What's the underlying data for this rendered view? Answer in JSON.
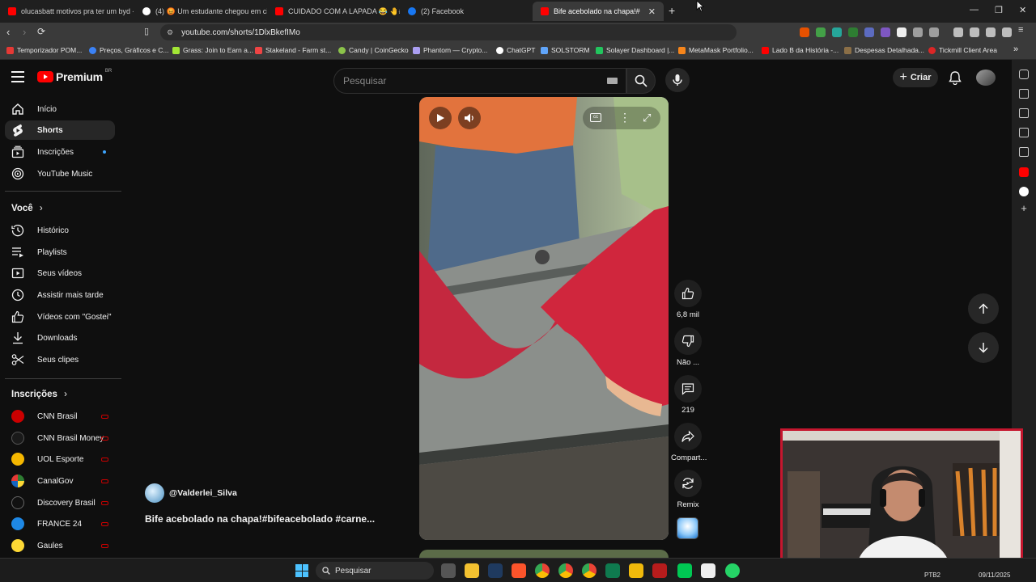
{
  "browser": {
    "tabs": [
      {
        "label": "olucasbatt motivos pra ter um byd -",
        "color": "#ff0000"
      },
      {
        "label": "(4) 😡 Um estudante chegou em cim",
        "color": "#ffffff"
      },
      {
        "label": "CUIDADO COM A LAPADA 😂 🤚#e",
        "color": "#ff0000"
      },
      {
        "label": "(2) Facebook",
        "color": "#1877f2"
      },
      {
        "label": "Bife acebolado na chapa!#bifea",
        "color": "#ff0000"
      }
    ],
    "new_tab": "+",
    "url": "youtube.com/shorts/1DlxBkefIMo",
    "bookmarks": [
      {
        "label": "Temporizador POM...",
        "color": "#e53935"
      },
      {
        "label": "Preços, Gráficos e C...",
        "color": "#3b82f6"
      },
      {
        "label": "Grass: Join to Earn a...",
        "color": "#a3e635"
      },
      {
        "label": "Stakeland - Farm st...",
        "color": "#ef4444"
      },
      {
        "label": "Candy | CoinGecko",
        "color": "#8bc34a"
      },
      {
        "label": "Phantom — Crypto...",
        "color": "#ab9ff2"
      },
      {
        "label": "ChatGPT",
        "color": "#ffffff"
      },
      {
        "label": "SOLSTORM",
        "color": "#60a5fa"
      },
      {
        "label": "Solayer Dashboard |...",
        "color": "#22c55e"
      },
      {
        "label": "MetaMask Portfolio...",
        "color": "#f6851b"
      },
      {
        "label": "Lado B da História -...",
        "color": "#ff0000"
      },
      {
        "label": "Despesas Detalhada...",
        "color": "#8b6f47"
      },
      {
        "label": "Tickmill Client Area",
        "color": "#dc2626"
      }
    ]
  },
  "youtube": {
    "logo_text": "Premium",
    "logo_badge": "BR",
    "search_placeholder": "Pesquisar",
    "create_label": "Criar",
    "sidebar": {
      "main": [
        {
          "label": "Início",
          "icon": "home-icon"
        },
        {
          "label": "Shorts",
          "icon": "shorts-icon"
        },
        {
          "label": "Inscrições",
          "icon": "subscriptions-icon"
        },
        {
          "label": "YouTube Music",
          "icon": "music-icon"
        }
      ],
      "you_heading": "Você",
      "you": [
        {
          "label": "Histórico",
          "icon": "history-icon"
        },
        {
          "label": "Playlists",
          "icon": "playlists-icon"
        },
        {
          "label": "Seus vídeos",
          "icon": "your-videos-icon"
        },
        {
          "label": "Assistir mais tarde",
          "icon": "watch-later-icon"
        },
        {
          "label": "Vídeos com \"Gostei\"",
          "icon": "liked-icon"
        },
        {
          "label": "Downloads",
          "icon": "download-icon"
        },
        {
          "label": "Seus clipes",
          "icon": "clips-icon"
        }
      ],
      "subs_heading": "Inscrições",
      "subscriptions": [
        {
          "label": "CNN Brasil",
          "color": "#cc0000"
        },
        {
          "label": "CNN Brasil Money",
          "color": "#1a1a1a"
        },
        {
          "label": "UOL Esporte",
          "color": "#f5b700"
        },
        {
          "label": "CanalGov",
          "color": "#2e7d32"
        },
        {
          "label": "Discovery Brasil",
          "color": "#111111"
        },
        {
          "label": "FRANCE 24",
          "color": "#1e88e5"
        },
        {
          "label": "Gaules",
          "color": "#fdd835"
        }
      ]
    },
    "short": {
      "channel": "@Valderlei_Silva",
      "title": "Bife acebolado na chapa!#bifeacebolado #carne..."
    },
    "actions": [
      {
        "name": "like",
        "label": "6,8 mil"
      },
      {
        "name": "dislike",
        "label": "Não ..."
      },
      {
        "name": "comments",
        "label": "219"
      },
      {
        "name": "share",
        "label": "Compart..."
      },
      {
        "name": "remix",
        "label": "Remix"
      }
    ]
  },
  "taskbar": {
    "search_placeholder": "Pesquisar",
    "lang": "PTB2",
    "date": "09/11/2025"
  }
}
